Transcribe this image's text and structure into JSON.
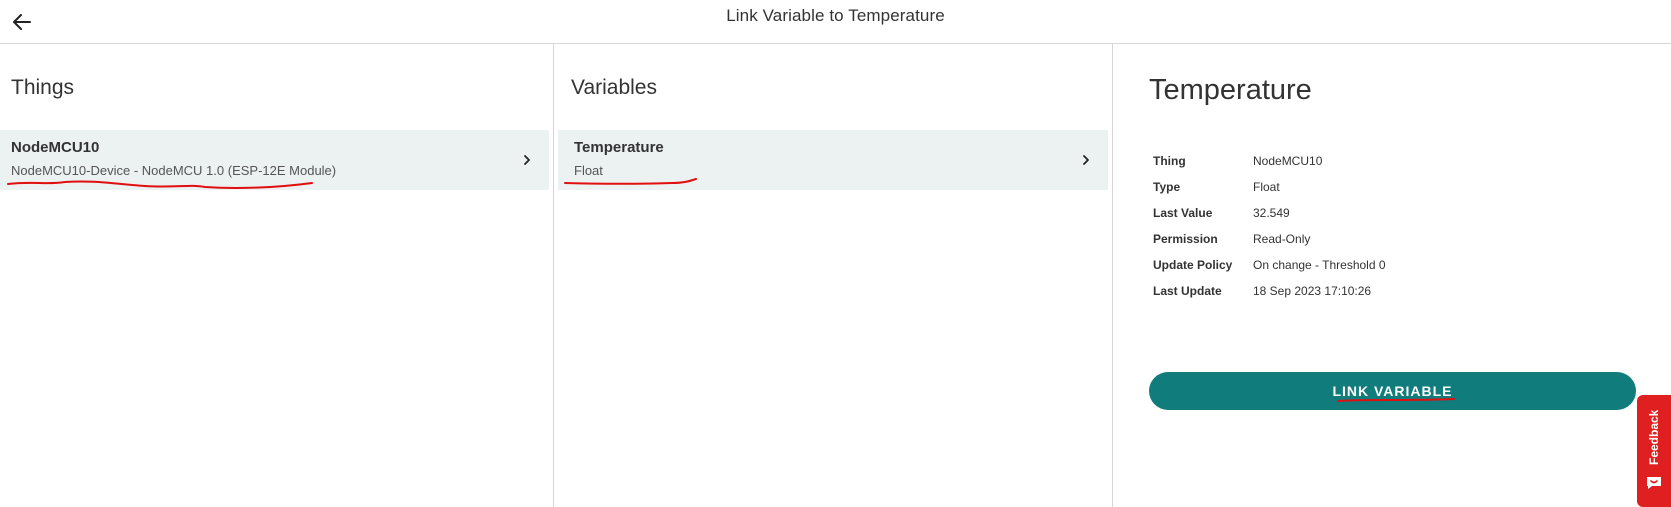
{
  "header": {
    "title": "Link Variable to Temperature",
    "back_icon": "arrow-left-icon"
  },
  "things": {
    "heading": "Things",
    "items": [
      {
        "name": "NodeMCU10",
        "subtitle": "NodeMCU10-Device - NodeMCU 1.0 (ESP-12E Module)"
      }
    ]
  },
  "variables": {
    "heading": "Variables",
    "items": [
      {
        "name": "Temperature",
        "subtitle": "Float"
      }
    ]
  },
  "detail": {
    "title": "Temperature",
    "rows": [
      {
        "key": "Thing",
        "value": "NodeMCU10"
      },
      {
        "key": "Type",
        "value": "Float"
      },
      {
        "key": "Last Value",
        "value": "32.549"
      },
      {
        "key": "Permission",
        "value": "Read-Only"
      },
      {
        "key": "Update Policy",
        "value": "On change - Threshold 0"
      },
      {
        "key": "Last Update",
        "value": "18 Sep 2023 17:10:26"
      }
    ],
    "link_button_label": "LINK VARIABLE"
  },
  "feedback": {
    "label": "Feedback"
  },
  "colors": {
    "accent": "#117c7c",
    "selected_row": "#ecf1f1",
    "feedback": "#e02020",
    "annotation": "#e01010"
  }
}
